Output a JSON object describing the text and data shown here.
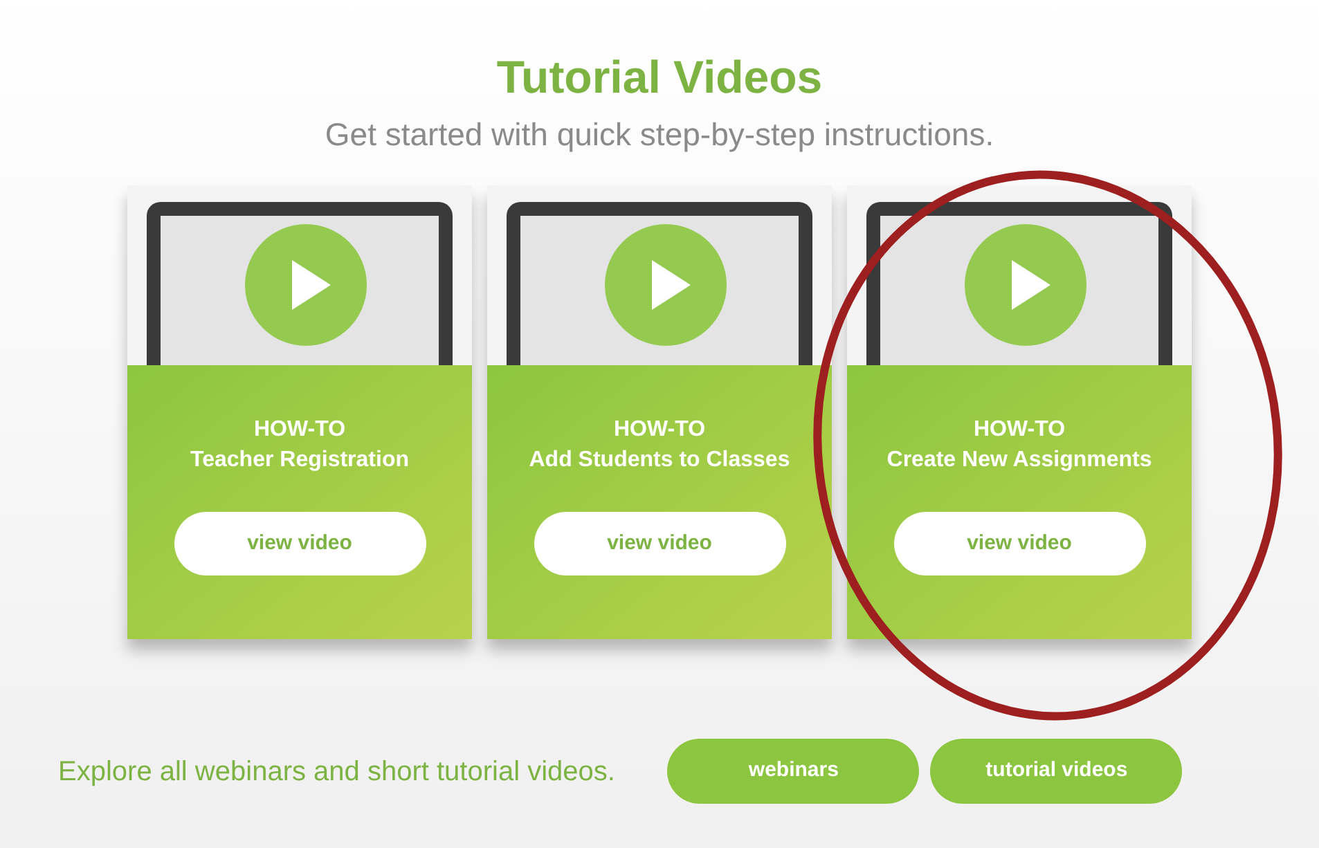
{
  "header": {
    "title": "Tutorial Videos",
    "subtitle": "Get started with quick step-by-step instructions."
  },
  "cards": [
    {
      "eyebrow": "HOW-TO",
      "title": "Teacher Registration",
      "button": "view video",
      "highlighted": false
    },
    {
      "eyebrow": "HOW-TO",
      "title": "Add Students to Classes",
      "button": "view video",
      "highlighted": false
    },
    {
      "eyebrow": "HOW-TO",
      "title": "Create New Assignments",
      "button": "view video",
      "highlighted": true
    }
  ],
  "footer": {
    "text": "Explore all webinars and short tutorial videos.",
    "buttons": [
      "webinars",
      "tutorial videos"
    ]
  }
}
